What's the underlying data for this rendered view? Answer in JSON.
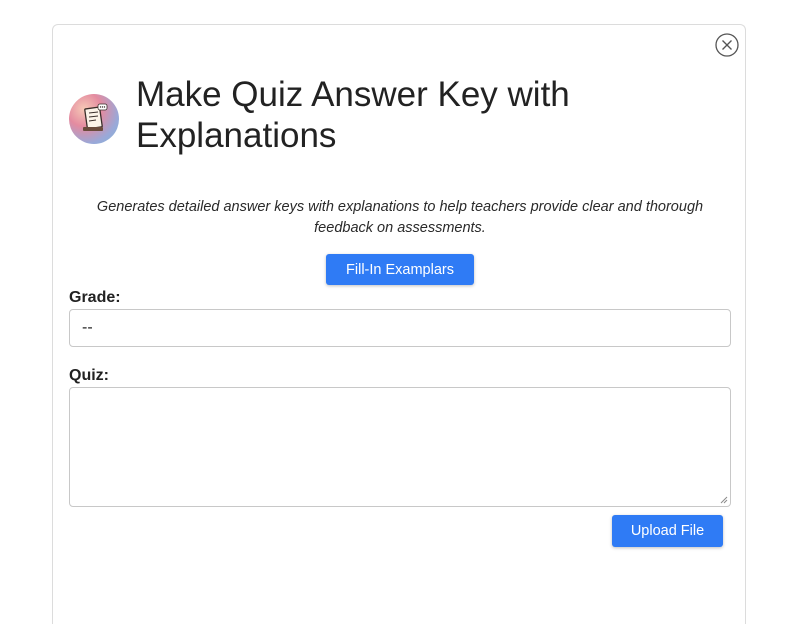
{
  "dialog": {
    "title": "Make Quiz Answer Key with Explanations",
    "description": "Generates detailed answer keys with explanations to help teachers provide clear and thorough feedback on assessments.",
    "close_icon": "close-circle-icon",
    "avatar_icon": "quiz-document-icon"
  },
  "actions": {
    "fill_in_label": "Fill-In Examplars",
    "upload_label": "Upload File"
  },
  "form": {
    "grade": {
      "label": "Grade:",
      "value": "--"
    },
    "quiz": {
      "label": "Quiz:",
      "value": ""
    }
  },
  "colors": {
    "primary_button": "#2f7bf5",
    "border": "#c8c8c8",
    "text": "#222222"
  }
}
